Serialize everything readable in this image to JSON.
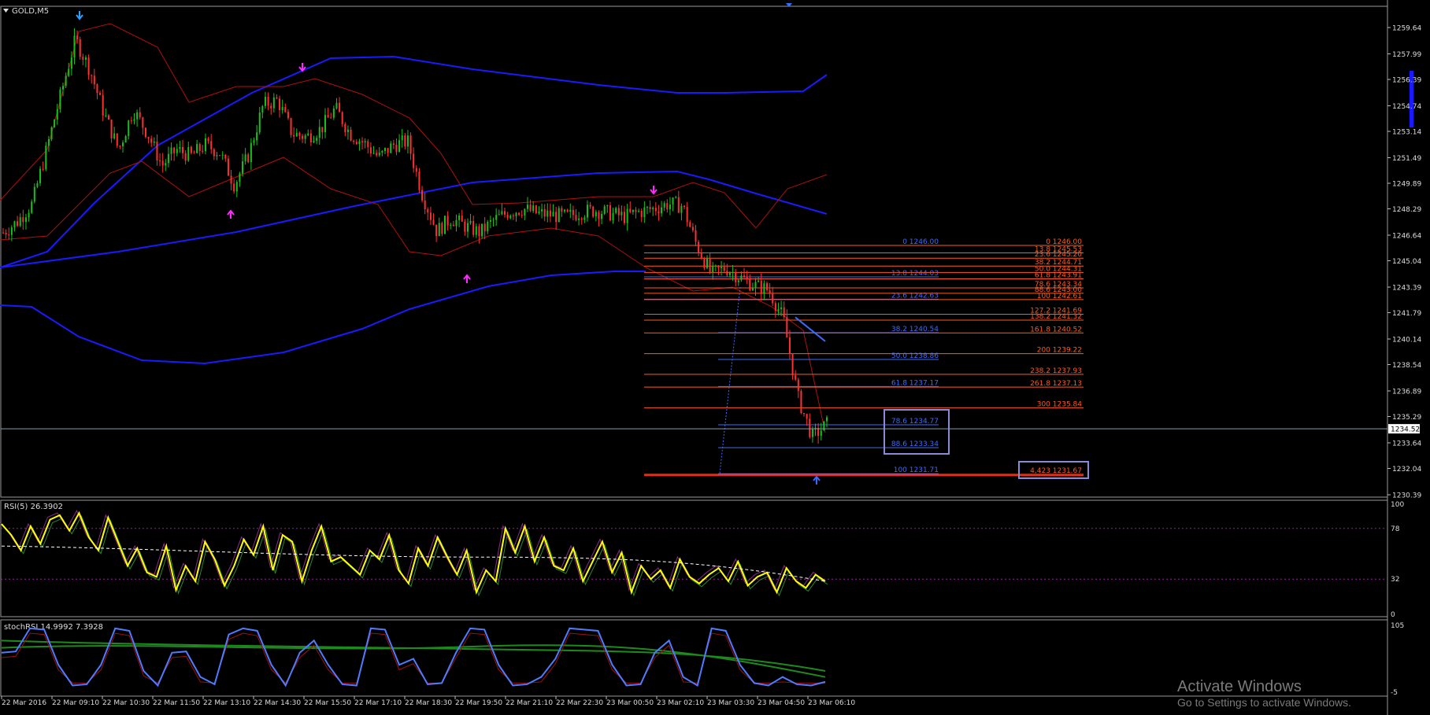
{
  "header": {
    "symbol_label": "GOLD,M5",
    "dropdown_icon": "triangle-down-icon"
  },
  "colors": {
    "background": "#000000",
    "bull_candle": "#18c018",
    "bear_candle": "#ff3030",
    "bollinger_inner": "#b01010",
    "envelope_outer": "#1a1aff",
    "fib_up": "#ff5a1a",
    "fib_down": "#3a6bff",
    "rsi_line": "#ffff00",
    "stoch_line": "#4f7cff",
    "stoch_signal": "#1e8a1e"
  },
  "chart_data": [
    {
      "type": "candlestick",
      "title": "GOLD,M5",
      "ylim": [
        1229.5,
        1261.0
      ],
      "y_ticks": [
        "1259.64",
        "1257.99",
        "1256.39",
        "1254.74",
        "1253.14",
        "1251.49",
        "1249.89",
        "1248.29",
        "1246.64",
        "1245.04",
        "1243.39",
        "1241.79",
        "1240.14",
        "1238.54",
        "1236.89",
        "1235.29",
        "1233.64",
        "1232.04",
        "1230.39"
      ],
      "current_price": "1234.52",
      "x_tick_labels": [
        "22 Mar 2016",
        "22 Mar 09:10",
        "22 Mar 10:30",
        "22 Mar 11:50",
        "22 Mar 13:10",
        "22 Mar 14:30",
        "22 Mar 15:50",
        "22 Mar 17:10",
        "22 Mar 18:30",
        "22 Mar 19:50",
        "22 Mar 21:10",
        "22 Mar 22:30",
        "23 Mar 00:50",
        "23 Mar 02:10",
        "23 Mar 03:30",
        "23 Mar 04:50",
        "23 Mar 06:10"
      ],
      "close_path": [
        1246.8,
        1247.5,
        1248.6,
        1252.0,
        1255.5,
        1258.9,
        1257.0,
        1254.2,
        1252.0,
        1254.5,
        1253.0,
        1251.0,
        1252.0,
        1251.6,
        1252.3,
        1251.8,
        1249.8,
        1251.7,
        1254.8,
        1255.1,
        1253.0,
        1252.8,
        1253.3,
        1254.6,
        1253.0,
        1252.4,
        1251.5,
        1252.3,
        1252.5,
        1249.2,
        1246.9,
        1247.7,
        1247.2,
        1246.8,
        1247.6,
        1248.1,
        1248.3,
        1248.0,
        1247.9,
        1247.8,
        1248.1,
        1248.2,
        1248.0,
        1247.8,
        1248.1,
        1248.3,
        1248.6,
        1248.5,
        1246.0,
        1244.2,
        1244.6,
        1244.0,
        1243.5,
        1243.2,
        1241.4,
        1236.5,
        1234.0,
        1234.8
      ],
      "fib_retracement_down": {
        "levels": [
          "0",
          "13.8",
          "23.6",
          "38.2",
          "50.0",
          "61.8",
          "78.6",
          "88.6",
          "100"
        ],
        "prices": [
          "1246.00",
          "1244.03",
          "1242.63",
          "1240.54",
          "1238.86",
          "1237.17",
          "1234.77",
          "1233.34",
          "1231.71"
        ]
      },
      "fib_extension_up": {
        "labels": [
          "0 1246.00",
          "13.8 1245.53",
          "23.6 1245.20",
          "38.2 1244.71",
          "50.0 1244.31",
          "61.8 1243.91",
          "78.6 1243.34",
          "88.6 1243.00",
          "100 1242.61",
          "127.2 1241.69",
          "138.2 1241.32",
          "161.8 1240.52",
          "200 1239.22",
          "238.2 1237.93",
          "261.8 1237.13",
          "300 1235.84",
          "4,423 1231.67"
        ],
        "prices": [
          1246.0,
          1245.53,
          1245.2,
          1244.71,
          1244.31,
          1243.91,
          1243.34,
          1243.0,
          1242.61,
          1241.69,
          1241.32,
          1240.52,
          1239.22,
          1237.93,
          1237.13,
          1235.84,
          1231.67
        ]
      }
    },
    {
      "type": "line",
      "title": "RSI(5) 26.3902",
      "ylim": [
        0,
        100
      ],
      "y_ticks": [
        "100",
        "78",
        "32",
        "0"
      ],
      "levels": [
        78,
        32
      ],
      "values": [
        82,
        72,
        58,
        80,
        64,
        86,
        90,
        76,
        92,
        70,
        58,
        88,
        66,
        44,
        60,
        38,
        34,
        62,
        22,
        44,
        30,
        66,
        50,
        26,
        44,
        68,
        54,
        80,
        40,
        72,
        66,
        30,
        58,
        80,
        48,
        52,
        44,
        36,
        58,
        50,
        72,
        40,
        28,
        60,
        44,
        70,
        52,
        36,
        58,
        20,
        40,
        30,
        78,
        56,
        80,
        48,
        70,
        44,
        40,
        60,
        30,
        48,
        66,
        38,
        56,
        20,
        44,
        32,
        40,
        24,
        50,
        34,
        28,
        36,
        42,
        30,
        48,
        26,
        34,
        38,
        20,
        42,
        30,
        24,
        36,
        30
      ]
    },
    {
      "type": "line",
      "title": "stochRSI 14.9992 7.3928",
      "ylim": [
        -5,
        105
      ],
      "y_ticks": [
        "105",
        "-5"
      ],
      "values": [
        60,
        62,
        100,
        98,
        40,
        6,
        8,
        40,
        100,
        96,
        30,
        6,
        60,
        62,
        20,
        8,
        90,
        100,
        96,
        40,
        6,
        60,
        80,
        40,
        8,
        6,
        100,
        98,
        40,
        50,
        8,
        10,
        60,
        100,
        98,
        40,
        6,
        8,
        20,
        50,
        100,
        98,
        96,
        40,
        6,
        8,
        60,
        80,
        20,
        6,
        100,
        96,
        40,
        10,
        6,
        20,
        8,
        6,
        12
      ]
    }
  ],
  "watermark": {
    "line1": "Activate Windows",
    "line2": "Go to Settings to activate Windows."
  }
}
